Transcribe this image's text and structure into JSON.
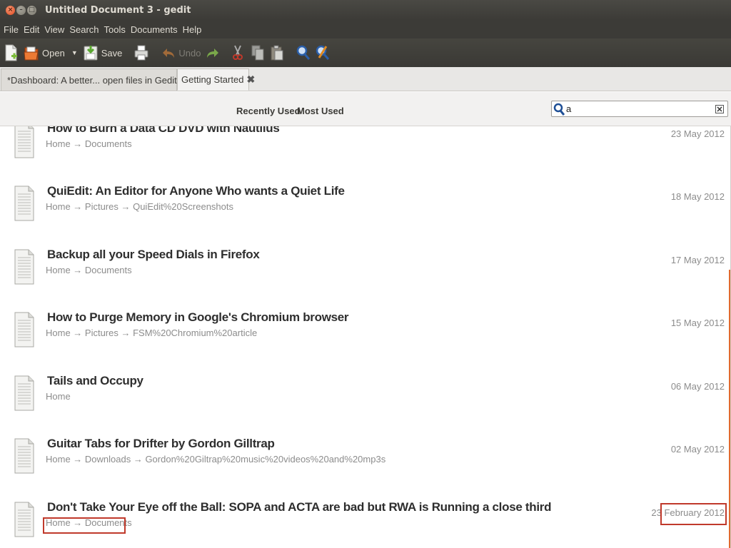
{
  "window": {
    "title": "Untitled Document 3 - gedit",
    "close_glyph": "×",
    "min_glyph": "–",
    "max_glyph": "□"
  },
  "menu": [
    "File",
    "Edit",
    "View",
    "Search",
    "Tools",
    "Documents",
    "Help"
  ],
  "toolbar": {
    "open_label": "Open",
    "save_label": "Save",
    "undo_label": "Undo",
    "dropdown_glyph": "▼"
  },
  "tabs": [
    {
      "label": "*Dashboard: A better... open files in Gedit",
      "active": false
    },
    {
      "label": "Getting Started",
      "active": true
    }
  ],
  "tab_close_glyph": "✖",
  "filter": {
    "recently_used": "Recently Used",
    "most_used": "Most Used",
    "search_value": "a"
  },
  "items": [
    {
      "title": "How to Burn a Data CD DVD with Nautilus",
      "path": "Home → Documents",
      "date": "23 May 2012"
    },
    {
      "title": "QuiEdit: An Editor for Anyone Who wants a Quiet Life",
      "path": "Home → Pictures → QuiEdit%20Screenshots",
      "date": "18 May 2012"
    },
    {
      "title": "Backup all your Speed Dials in Firefox",
      "path": "Home → Documents",
      "date": "17 May 2012"
    },
    {
      "title": "How to Purge Memory in Google's Chromium browser",
      "path": "Home → Pictures → FSM%20Chromium%20article",
      "date": "15 May 2012"
    },
    {
      "title": "Tails and Occupy",
      "path": "Home",
      "date": "06 May 2012"
    },
    {
      "title": "Guitar Tabs for Drifter by Gordon Gilltrap",
      "path": "Home → Downloads → Gordon%20Giltrap%20music%20videos%20and%20mp3s",
      "date": "02 May 2012"
    },
    {
      "title": "Don't Take Your Eye off the Ball: SOPA and ACTA are bad but RWA is Running a close third",
      "path": "Home → Documents",
      "date": "23 February 2012"
    }
  ],
  "colors": {
    "highlight": "#c0392b",
    "scroll_accent": "#e06a2e",
    "title_bar": "#3c3b37"
  }
}
